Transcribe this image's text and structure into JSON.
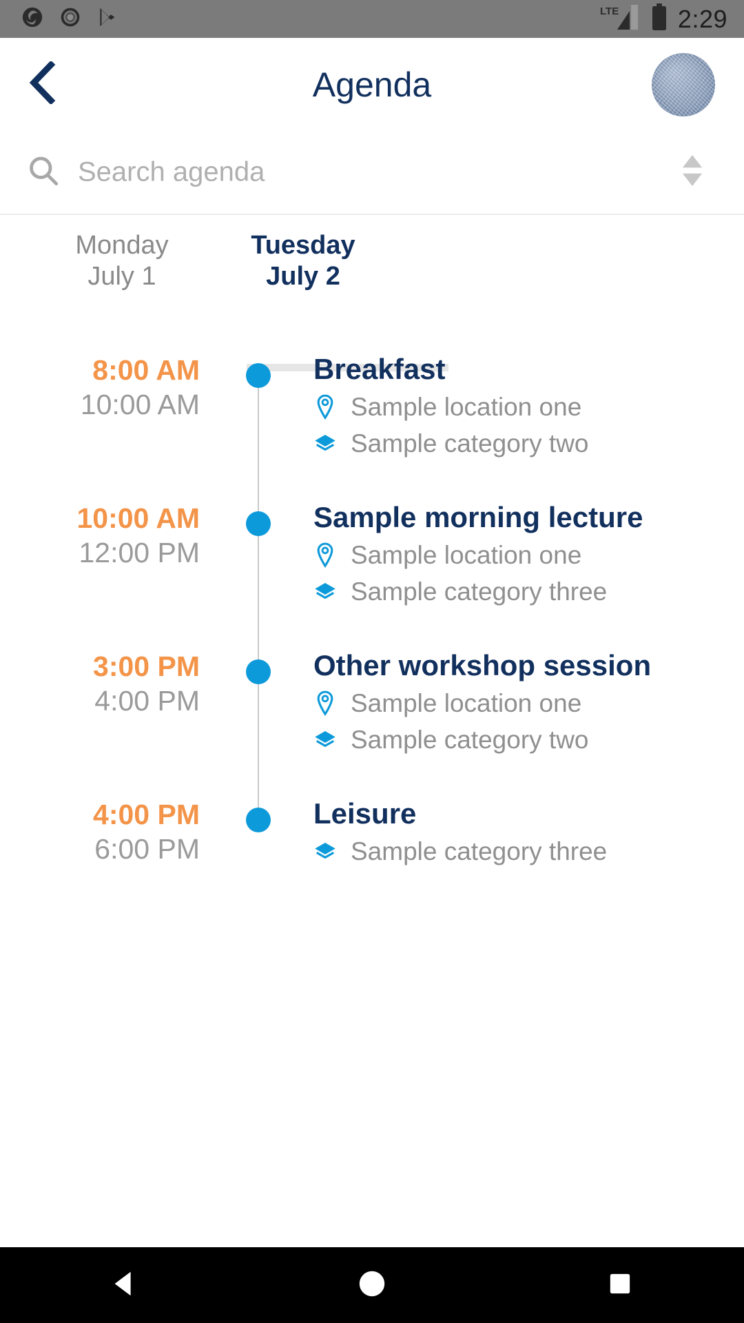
{
  "status_bar": {
    "app_icons": [
      "aperture-logo-icon",
      "circle-record-icon",
      "play-store-icon"
    ],
    "network": "LTE",
    "battery_icon": "battery-full-icon",
    "time": "2:29"
  },
  "header": {
    "back_icon": "chevron-left-icon",
    "title": "Agenda",
    "avatar_icon": "user-avatar"
  },
  "search": {
    "icon": "search-icon",
    "placeholder": "Search agenda",
    "value": "",
    "sort_icon": "sort-ascending-descending-icon"
  },
  "tabs": [
    {
      "day": "Monday",
      "date": "July 1",
      "active": false
    },
    {
      "day": "Tuesday",
      "date": "July 2",
      "active": true
    }
  ],
  "events": [
    {
      "start": "8:00 AM",
      "end": "10:00 AM",
      "title": "Breakfast",
      "location": "Sample location one",
      "category": "Sample category two"
    },
    {
      "start": "10:00 AM",
      "end": "12:00 PM",
      "title": "Sample morning lecture",
      "location": "Sample location one",
      "category": "Sample category three"
    },
    {
      "start": "3:00 PM",
      "end": "4:00 PM",
      "title": "Other workshop session",
      "location": "Sample location one",
      "category": "Sample category two"
    },
    {
      "start": "4:00 PM",
      "end": "6:00 PM",
      "title": "Leisure",
      "location": null,
      "category": "Sample category three"
    }
  ],
  "nav_bar": {
    "back": "nav-back-triangle-icon",
    "home": "nav-home-circle-icon",
    "recents": "nav-recents-square-icon"
  },
  "colors": {
    "navy": "#12305e",
    "orange": "#f39449",
    "blue": "#0d9ada",
    "gray_text": "#8f8f8f",
    "status_bar_bg": "#7b7b7b"
  }
}
